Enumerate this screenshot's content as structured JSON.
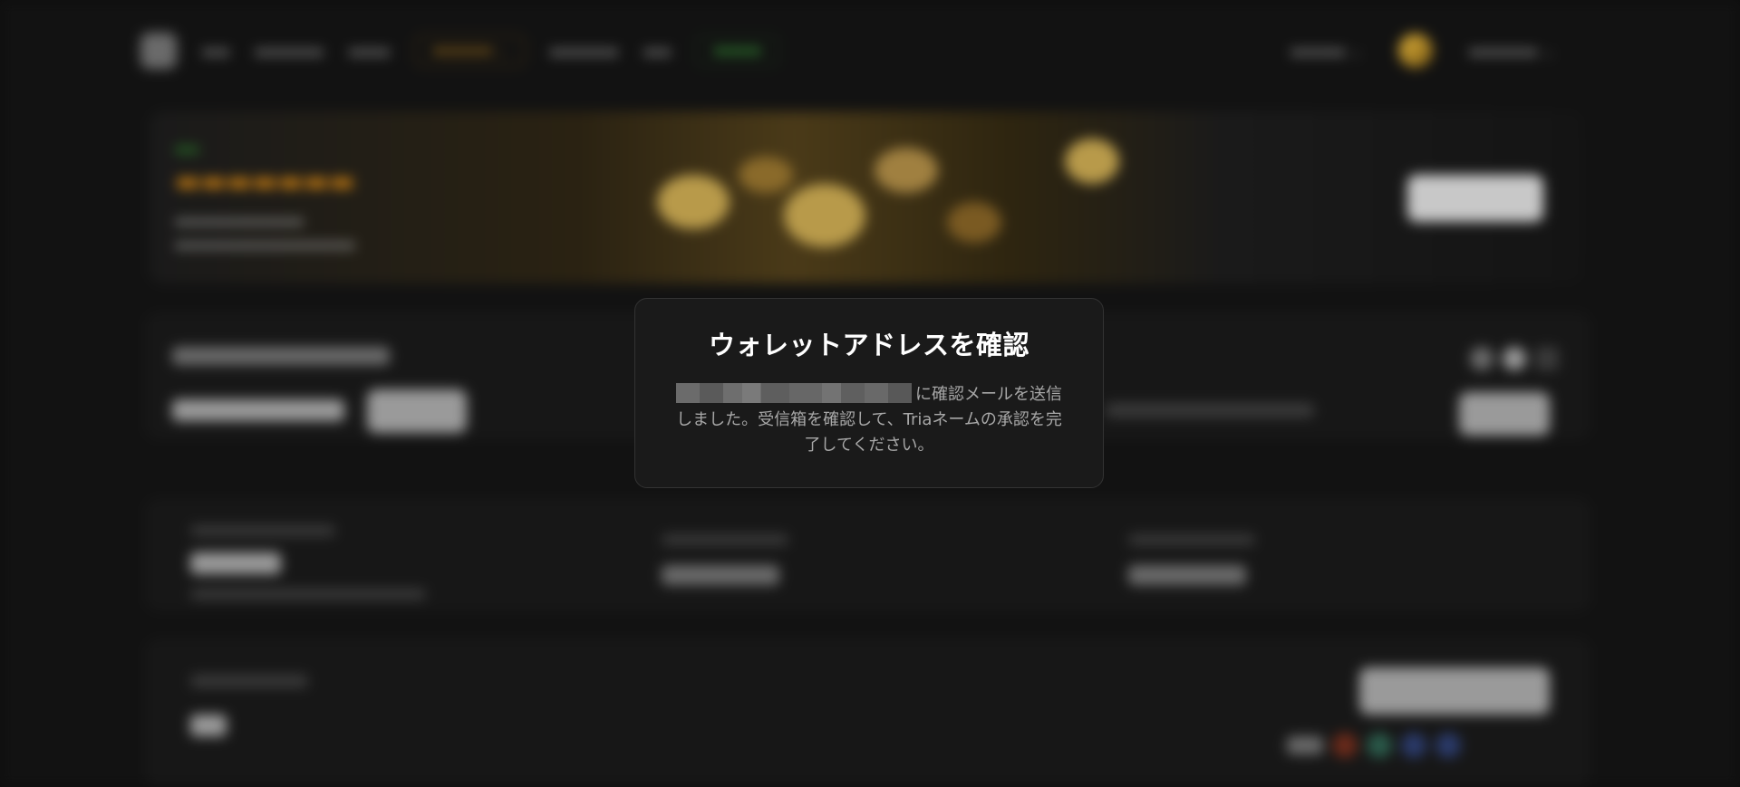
{
  "modal": {
    "title": "ウォレットアドレスを確認",
    "message_suffix": "に確認メールを送信しました。受信箱を確認して、Triaネームの承認を完了してください。"
  }
}
